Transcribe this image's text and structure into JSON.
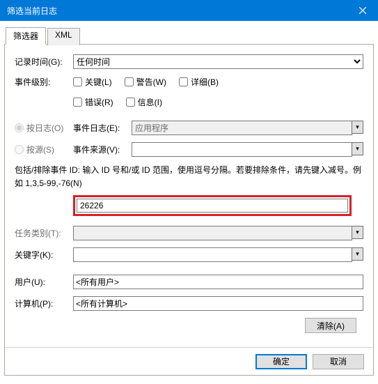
{
  "window": {
    "title": "筛选当前日志"
  },
  "tabs": {
    "filter": "筛选器",
    "xml": "XML"
  },
  "labels": {
    "logged": "记录时间(G):",
    "event_level": "事件级别:",
    "by_log": "按日志(O)",
    "by_source": "按源(S)",
    "event_log": "事件日志(E):",
    "event_source": "事件来源(V):",
    "help_text": "包括/排除事件 ID: 输入 ID 号和/或 ID 范围，使用逗号分隔。若要排除条件，请先键入减号。例如 1,3,5-99,-76(N)",
    "task_category": "任务类别(T):",
    "keywords": "关键字(K):",
    "user": "用户(U):",
    "computer": "计算机(P):"
  },
  "values": {
    "logged_time": "任何时间",
    "event_log": "应用程序",
    "event_source": "",
    "event_id": "26226",
    "task_category": "",
    "keywords": "",
    "user": "<所有用户>",
    "computer": "<所有计算机>"
  },
  "checkboxes": {
    "critical": "关键(L)",
    "warning": "警告(W)",
    "verbose": "详细(B)",
    "error": "错误(R)",
    "information": "信息(I)"
  },
  "buttons": {
    "clear": "清除(A)",
    "ok": "确定",
    "cancel": "取消"
  }
}
